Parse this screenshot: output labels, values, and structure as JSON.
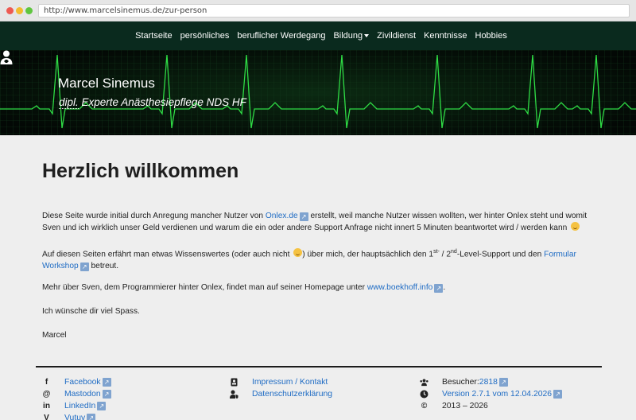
{
  "browser": {
    "url": "http://www.marcelsinemus.de/zur-person"
  },
  "nav": {
    "items": [
      {
        "label": "Startseite"
      },
      {
        "label": "persönliches"
      },
      {
        "label": "beruflicher Werdegang"
      },
      {
        "label": "Bildung"
      },
      {
        "label": "Zivildienst"
      },
      {
        "label": "Kenntnisse"
      },
      {
        "label": "Hobbies"
      }
    ]
  },
  "hero": {
    "name": "Marcel Sinemus",
    "subtitle_abbr": "dipl.",
    "subtitle_rest": " Experte Anästhesiepflege NDS HF"
  },
  "main": {
    "title": "Herzlich willkommen",
    "p1_a": "Diese Seite wurde initial durch Anregung mancher Nutzer von ",
    "p1_link": "Onlex.de",
    "p1_b": " erstellt, weil manche Nutzer wissen wollten, wer hinter Onlex steht und womit Sven und ich wirklich unser Geld verdienen und warum die ein oder andere Support Anfrage nicht innert 5 Minuten beantwortet wird / werden kann",
    "p2_a": "Auf diesen Seiten erfährt man etwas Wissenswertes (oder auch nicht ",
    "p2_b": ") über mich, der hauptsächlich den 1",
    "p2_sup1": "st-",
    "p2_c": " / 2",
    "p2_sup2": "nd",
    "p2_d": "-Level-Support und den ",
    "p2_link": "Formular Workshop",
    "p2_e": " betreut.",
    "p3_a": "Mehr über Sven, dem Programmierer hinter Onlex, findet man auf seiner Homepage unter ",
    "p3_link": "www.boekhoff.info",
    "p3_b": ".",
    "p4": "Ich wünsche dir viel Spass.",
    "p5": "Marcel"
  },
  "footer": {
    "social": [
      {
        "icon": "f",
        "label": "Facebook"
      },
      {
        "icon": "@",
        "label": "Mastodon"
      },
      {
        "icon": "in",
        "label": "LinkedIn"
      },
      {
        "icon": "V",
        "label": "Vutuv"
      }
    ],
    "legal": [
      {
        "label": "Impressum / Kontakt"
      },
      {
        "label": "Datenschutzerklärung"
      }
    ],
    "info": {
      "visitors_label": "Besucher: ",
      "visitors_value": "2818",
      "version": "Version 2.7.1 vom 12.04.2026",
      "copyright_symbol": "©",
      "copyright": "2013 – 2026"
    }
  },
  "colors": {
    "link": "#1f6cc4",
    "nav_bg": "#0a2a1e",
    "ecg_green": "#2fdc45"
  }
}
